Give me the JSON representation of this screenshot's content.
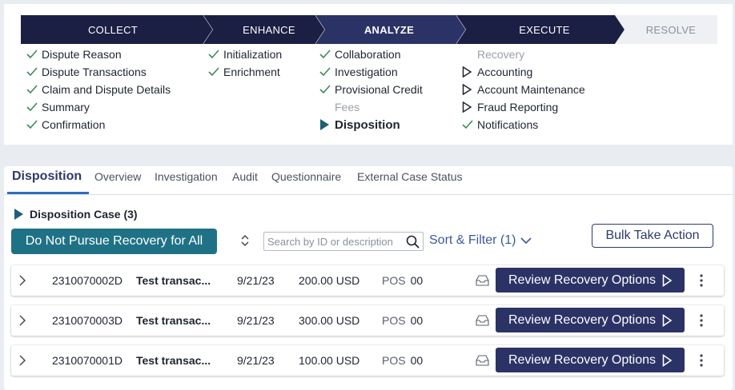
{
  "stages": [
    {
      "label": "COLLECT",
      "state": "done"
    },
    {
      "label": "ENHANCE",
      "state": "done"
    },
    {
      "label": "ANALYZE",
      "state": "active"
    },
    {
      "label": "EXECUTE",
      "state": "done"
    },
    {
      "label": "RESOLVE",
      "state": "future"
    }
  ],
  "steps": {
    "collect": [
      "Dispute Reason",
      "Dispute Transactions",
      "Claim and Dispute Details",
      "Summary",
      "Confirmation"
    ],
    "enhance": [
      "Initialization",
      "Enrichment"
    ],
    "analyze": [
      "Collaboration",
      "Investigation",
      "Provisional Credit",
      "Fees",
      "Disposition"
    ],
    "execute": [
      "Recovery",
      "Accounting",
      "Account Maintenance",
      "Fraud Reporting",
      "Notifications"
    ]
  },
  "tabs": [
    "Disposition",
    "Overview",
    "Investigation",
    "Audit",
    "Questionnaire",
    "External Case Status"
  ],
  "case_header": "Disposition Case (3)",
  "actions": {
    "dnp_label": "Do Not Pursue Recovery for All",
    "search_placeholder": "Search by ID or description",
    "sort_filter_label": "Sort & Filter (1)",
    "bulk_label": "Bulk Take Action"
  },
  "rows": [
    {
      "id": "2310070002D",
      "description": "Test transac...",
      "date": "9/21/23",
      "amount": "200.00 USD",
      "pos_label": "POS",
      "pos_value": "00",
      "action": "Review Recovery Options"
    },
    {
      "id": "2310070003D",
      "description": "Test transac...",
      "date": "9/21/23",
      "amount": "300.00 USD",
      "pos_label": "POS",
      "pos_value": "00",
      "action": "Review Recovery Options"
    },
    {
      "id": "2310070001D",
      "description": "Test transac...",
      "date": "9/21/23",
      "amount": "100.00 USD",
      "pos_label": "POS",
      "pos_value": "00",
      "action": "Review Recovery Options"
    }
  ],
  "colors": {
    "stage_dark": "#1b1f43",
    "stage_active": "#2b3366",
    "stage_future": "#eef0f3",
    "check_green": "#3d8a5b",
    "teal_button": "#1f7285",
    "navy_button": "#2b3366",
    "link_blue": "#3b5a9a"
  },
  "icons": {
    "done_step": "check-icon",
    "pending_step": "outline-play-icon",
    "current_step": "filled-play-icon",
    "row_expand": "chevron-right-icon",
    "row_inbox": "inbox-icon",
    "row_more": "more-vertical-icon",
    "search": "search-icon",
    "sort": "sort-icon"
  }
}
